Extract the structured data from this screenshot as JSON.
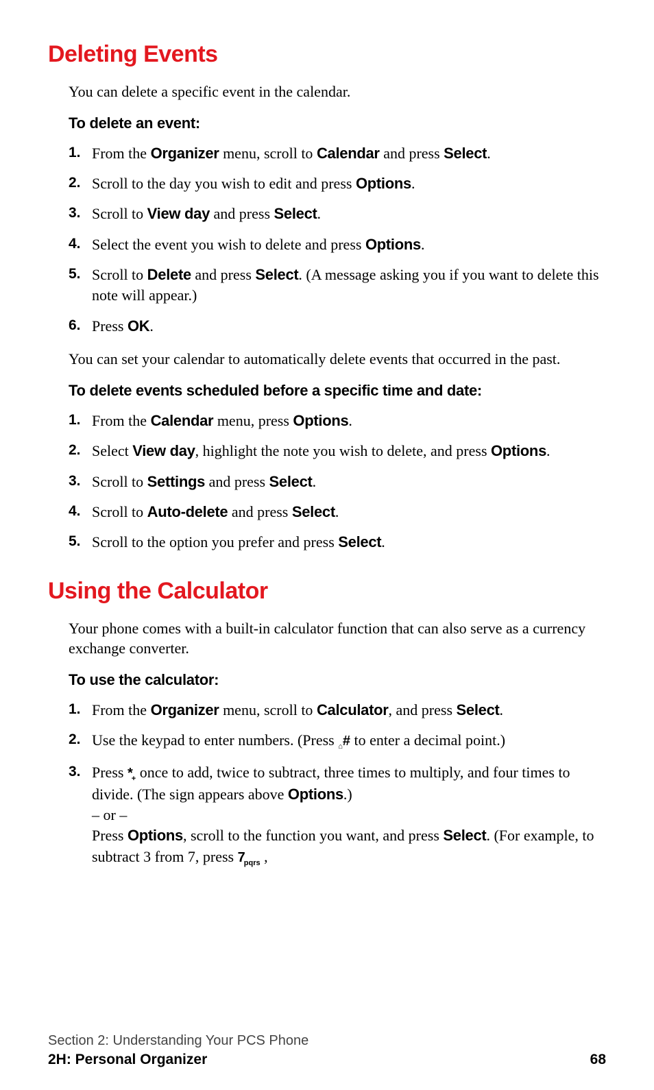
{
  "sec1": {
    "heading": "Deleting Events",
    "intro": "You can delete a specific event in the calendar.",
    "procA": "To delete an event:",
    "listA": {
      "i1": {
        "n": "1.",
        "pre": "From the ",
        "b1": "Organizer",
        "mid1": " menu, scroll to ",
        "b2": "Calendar",
        "mid2": " and press ",
        "b3": "Select",
        "post": "."
      },
      "i2": {
        "n": "2.",
        "pre": "Scroll to the day you wish to edit and press ",
        "b1": "Options",
        "post": "."
      },
      "i3": {
        "n": "3.",
        "pre": "Scroll to ",
        "b1": "View day",
        "mid1": " and press ",
        "b2": "Select",
        "post": "."
      },
      "i4": {
        "n": "4.",
        "pre": "Select the event you wish to delete and press ",
        "b1": "Options",
        "post": "."
      },
      "i5": {
        "n": "5.",
        "pre": "Scroll to ",
        "b1": "Delete",
        "mid1": " and press ",
        "b2": "Select",
        "post": ". (A message asking you if you want to delete this note will appear.)"
      },
      "i6": {
        "n": "6.",
        "pre": "Press ",
        "b1": "OK",
        "post": "."
      }
    },
    "paraB": "You can set your calendar to automatically delete events that occurred in the past.",
    "procB": "To delete events scheduled before a specific time and date:",
    "listB": {
      "i1": {
        "n": "1.",
        "pre": "From the ",
        "b1": "Calendar",
        "mid1": " menu, press ",
        "b2": "Options",
        "post": "."
      },
      "i2": {
        "n": "2.",
        "pre": "Select ",
        "b1": "View day",
        "mid1": ", highlight the note you wish to delete, and press ",
        "b2": "Options",
        "post": "."
      },
      "i3": {
        "n": "3.",
        "pre": "Scroll to ",
        "b1": "Settings",
        "mid1": " and press ",
        "b2": "Select",
        "post": "."
      },
      "i4": {
        "n": "4.",
        "pre": "Scroll to ",
        "b1": "Auto-delete",
        "mid1": " and press ",
        "b2": "Select",
        "post": "."
      },
      "i5": {
        "n": "5.",
        "pre": "Scroll to the option you prefer and press ",
        "b1": "Select",
        "post": "."
      }
    }
  },
  "sec2": {
    "heading": "Using the Calculator",
    "intro": "Your phone comes with a built-in calculator function that can also serve as a currency exchange converter.",
    "procA": "To use the calculator:",
    "listA": {
      "i1": {
        "n": "1.",
        "pre": "From the ",
        "b1": "Organizer",
        "mid1": " menu, scroll to ",
        "b2": "Calculator",
        "mid2": ", and press ",
        "b3": "Select",
        "post": "."
      },
      "i2": {
        "n": "2.",
        "pre": "Use the keypad to enter numbers. (Press ",
        "key": "hash",
        "post": " to enter a decimal point.)"
      },
      "i3": {
        "n": "3.",
        "pre": "Press ",
        "key": "star",
        "mid1": " once to add, twice to subtract, three times to multiply, and four times to divide. (The sign appears above ",
        "b1": "Options",
        "post1": ".)",
        "or": "– or –",
        "p2a": "Press ",
        "b2": "Options",
        "p2b": ", scroll to the function you want, and press ",
        "b3": "Select",
        "p2c": ". (For example, to subtract 3 from 7, press ",
        "key2": "7pqrs",
        "p2d": " ,"
      }
    }
  },
  "footer": {
    "l1": "Section 2: Understanding Your PCS Phone",
    "l2": "2H: Personal Organizer",
    "page": "68"
  },
  "keys": {
    "hash": {
      "main": "#",
      "sub": "⌂"
    },
    "star": {
      "main": "*",
      "sub": "+"
    },
    "7pqrs": {
      "main": "7",
      "sub": "pqrs"
    }
  }
}
